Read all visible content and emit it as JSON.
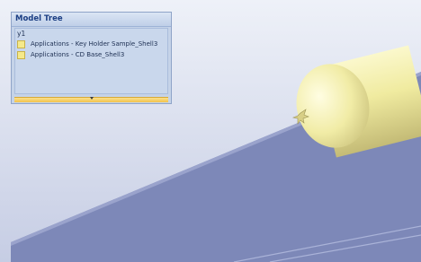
{
  "model_tree": {
    "title": "Model Tree",
    "root_label": "y1",
    "items": [
      {
        "label": "Applications - Key Holder Sample_Shell3"
      },
      {
        "label": "Applications - CD Base_Shell3"
      }
    ]
  },
  "colors": {
    "viewport_top": "#e6eaf5",
    "viewport_bottom": "#c9d0e6",
    "plane": "#7d88b8",
    "part": "#f0eca4",
    "panel_header_text": "#1b3e83"
  },
  "icons": {
    "tree_item": "part-icon",
    "footer": "chevron-down-icon"
  }
}
